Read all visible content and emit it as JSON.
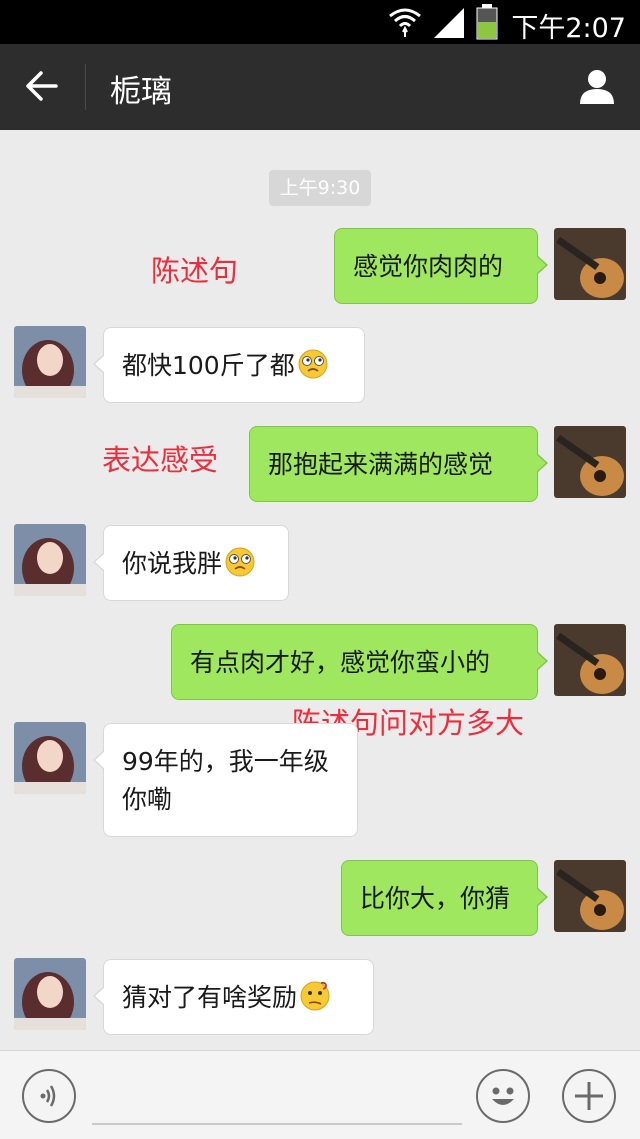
{
  "status_bar": {
    "time": "下午2:07"
  },
  "header": {
    "contact_name": "栀璃"
  },
  "chat": {
    "timestamp": "上午9:30",
    "messages": [
      {
        "side": "right",
        "text": "感觉你肉肉的"
      },
      {
        "side": "left",
        "text": "都快100斤了都",
        "emoji": "dazed-emoji"
      },
      {
        "side": "right",
        "text": "那抱起来满满的感觉"
      },
      {
        "side": "left",
        "text": "你说我胖",
        "emoji": "dazed-emoji"
      },
      {
        "side": "right",
        "text": "有点肉才好，感觉你蛮小的"
      },
      {
        "side": "left",
        "line1": "99年的，我一年级",
        "line2": "你嘞"
      },
      {
        "side": "right",
        "text": "比你大，你猜"
      },
      {
        "side": "left",
        "text": "猜对了有啥奖励",
        "emoji": "puzzled-emoji"
      }
    ]
  },
  "annotations": {
    "a1": "陈述句",
    "a2": "表达感受",
    "a3": "陈述句问对方多大"
  },
  "colors": {
    "sent_bubble": "#9ee75f",
    "received_bubble": "#ffffff",
    "annotation": "#ee2d3c",
    "header_bg": "#2d2d2e"
  }
}
